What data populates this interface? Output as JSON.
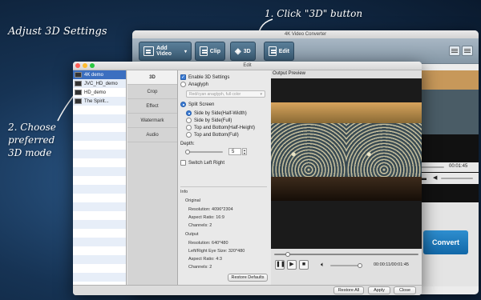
{
  "hints": {
    "title": "Adjust 3D Settings",
    "step1": "1. Click \"3D\" button",
    "step2_line1": "2. Choose",
    "step2_line2": "preferred",
    "step2_line3": "3D mode"
  },
  "main_window": {
    "title": "4K Video Converter",
    "toolbar": {
      "add_video": "Add Video",
      "clip": "Clip",
      "three_d": "3D",
      "edit": "Edit"
    },
    "time_right": "00:01:45",
    "convert": "Convert"
  },
  "edit_window": {
    "title": "Edit",
    "files": [
      "4K demo",
      "JVC_HD_demo",
      "HD_demo",
      "The Spirit..."
    ],
    "tabs": [
      "3D",
      "Crop",
      "Effect",
      "Watermark",
      "Audio"
    ],
    "settings": {
      "enable_3d": "Enable 3D Settings",
      "anaglyph": "Anaglyph",
      "anaglyph_select": "Red/cyan anaglyph, full color",
      "split_screen": "Split Screen",
      "sbs_half": "Side by Side(Half-Width)",
      "sbs_full": "Side by Side(Full)",
      "tab_half": "Top and Bottom(Half-Height)",
      "tab_full": "Top and Bottom(Full)",
      "depth_label": "Depth:",
      "depth_value": "5",
      "switch_lr": "Switch Left Right"
    },
    "info": {
      "heading": "Info",
      "original_heading": "Original",
      "orig_resolution": "Resolution: 4096*2304",
      "orig_aspect": "Aspect Ratio: 16:9",
      "orig_channels": "Channels: 2",
      "output_heading": "Output",
      "out_resolution": "Resolution: 640*480",
      "out_eye": "Left/Right Eye Size: 320*480",
      "out_aspect": "Aspect Ratio: 4:3",
      "out_channels": "Channels: 2"
    },
    "restore_defaults": "Restore Defaults",
    "preview_label": "Output Preview",
    "time_display": "00:00:11/00:01:45",
    "restore_all": "Restore All",
    "apply": "Apply",
    "close": "Close"
  }
}
